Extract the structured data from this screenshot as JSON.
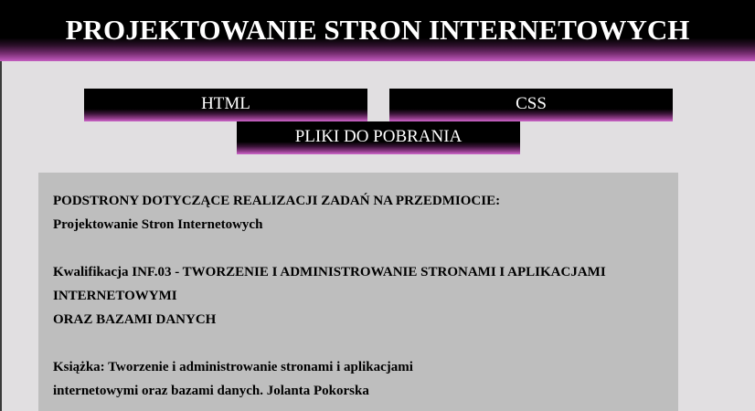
{
  "header": {
    "title": "PROJEKTOWANIE STRON INTERNETOWYCH"
  },
  "nav": {
    "html_label": "HTML",
    "css_label": "CSS",
    "downloads_label": "PLIKI DO POBRANIA"
  },
  "content": {
    "section1": {
      "line1": "PODSTRONY DOTYCZĄCE REALIZACJI ZADAŃ NA PRZEDMIOCIE:",
      "line2": "Projektowanie Stron Internetowych"
    },
    "section2": {
      "line1": "Kwalifikacja INF.03 - TWORZENIE I ADMINISTROWANIE STRONAMI I APLIKACJAMI",
      "line2": "INTERNETOWYMI",
      "line3": "ORAZ BAZAMI DANYCH"
    },
    "section3": {
      "line1": "Książka: Tworzenie i administrowanie stronami i aplikacjami",
      "line2": "internetowymi oraz bazami danych. Jolanta Pokorska"
    }
  },
  "colors": {
    "page_background": "#e1dfe1",
    "header_background": "#000000",
    "accent_gradient": "#c45cc0",
    "content_background": "#bebebe",
    "header_text": "#ffffff"
  }
}
